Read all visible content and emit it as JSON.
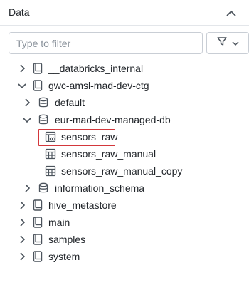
{
  "panel": {
    "title": "Data",
    "collapse_icon": "chevron-up-icon"
  },
  "filter": {
    "placeholder": "Type to filter",
    "button_icon": "filter-funnel-icon",
    "dropdown_icon": "chevron-down-icon"
  },
  "tree": {
    "items": [
      {
        "label": "__databricks_internal",
        "icon": "catalog-book-icon",
        "expanded": false
      },
      {
        "label": "gwc-amsl-mad-dev-ctg",
        "icon": "catalog-book-icon",
        "expanded": true
      },
      {
        "label": "default",
        "icon": "database-icon",
        "expanded": false
      },
      {
        "label": "eur-mad-dev-managed-db",
        "icon": "database-icon",
        "expanded": true
      },
      {
        "label": "sensors_raw",
        "icon": "streaming-table-icon",
        "selected": true
      },
      {
        "label": "sensors_raw_manual",
        "icon": "table-icon"
      },
      {
        "label": "sensors_raw_manual_copy",
        "icon": "table-icon"
      },
      {
        "label": "information_schema",
        "icon": "database-icon",
        "expanded": false
      },
      {
        "label": "hive_metastore",
        "icon": "catalog-book-icon",
        "expanded": false
      },
      {
        "label": "main",
        "icon": "catalog-book-icon",
        "expanded": false
      },
      {
        "label": "samples",
        "icon": "catalog-book-icon",
        "expanded": false
      },
      {
        "label": "system",
        "icon": "catalog-book-icon",
        "expanded": false
      }
    ]
  },
  "colors": {
    "text": "#1f2328",
    "border": "#c9ced5",
    "selection_outline": "#d3373b",
    "icon": "#4b535c"
  }
}
